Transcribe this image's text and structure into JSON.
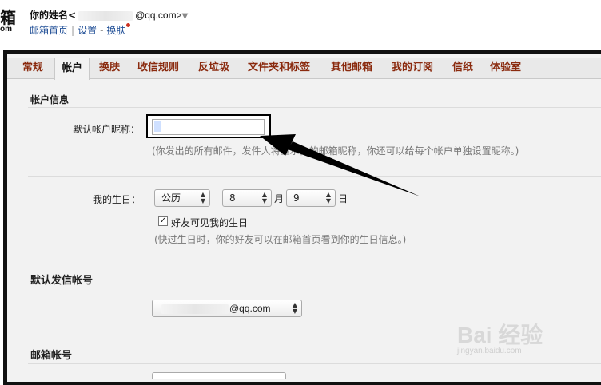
{
  "header": {
    "logo_char": "箱",
    "logo_sub": "om",
    "user_name": "你的姓名<",
    "user_email_domain": "@qq.com>",
    "caret": "▼",
    "links": [
      "邮箱首页",
      "设置",
      "换肤"
    ],
    "separator_1": "|",
    "separator_2": "-"
  },
  "tabs": [
    "常规",
    "帐户",
    "换肤",
    "收信规则",
    "反垃圾",
    "文件夹和标签",
    "其他邮箱",
    "我的订阅",
    "信纸",
    "体验室"
  ],
  "active_tab": "帐户",
  "account_info": {
    "title": "帐户信息",
    "nickname_label": "默认帐户昵称：",
    "nickname_value": "",
    "nickname_hint": "(你发出的所有邮件，发件人将显示你的邮箱昵称，你还可以给每个帐户单独设置昵称。)"
  },
  "birthday": {
    "label": "我的生日：",
    "calendar": "公历",
    "month": "8",
    "month_unit": "月",
    "day": "9",
    "day_unit": "日",
    "friends_visible_checked": true,
    "friends_visible_label": "好友可见我的生日",
    "hint": "(快过生日时，你的好友可以在邮箱首页看到你的生日信息。)"
  },
  "default_sender": {
    "title": "默认发信帐号",
    "account_domain": "@qq.com"
  },
  "mailbox_accounts": {
    "title": "邮箱帐号"
  },
  "watermark": {
    "main": "Bai 经验",
    "sub": "jingyan.baidu.com"
  },
  "colors": {
    "tab_text": "#8a2a0e",
    "link": "#1f4e96",
    "annotation": "#000000"
  }
}
